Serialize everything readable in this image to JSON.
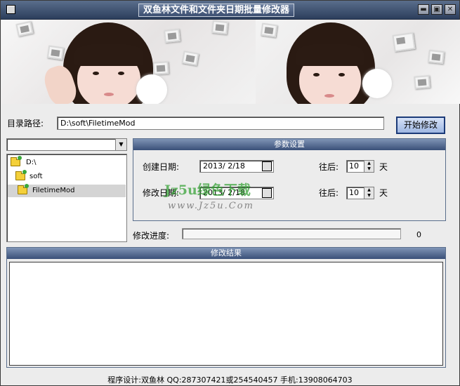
{
  "window": {
    "title": "双鱼林文件和文件夹日期批量修改器",
    "min_glyph": "▬",
    "max_glyph": "▣",
    "close_glyph": "✕"
  },
  "path": {
    "label": "目录路径:",
    "value": "D:\\soft\\FiletimeMod"
  },
  "start_button": "开始修改",
  "drive": {
    "value": "",
    "arrow": "▼"
  },
  "tree": {
    "items": [
      {
        "label": "D:\\"
      },
      {
        "label": "soft"
      },
      {
        "label": "FiletimeMod",
        "selected": true
      }
    ]
  },
  "params": {
    "title": "参数设置",
    "created_label": "创建日期:",
    "created_value": "2013/ 2/18",
    "modified_label": "修改日期:",
    "modified_value": "2013/ 2/18",
    "offset_label": "往后:",
    "created_offset": "10",
    "modified_offset": "10",
    "day_unit": "天"
  },
  "watermark": {
    "text": "Jz5u绿色下载",
    "url": "www.Jz5u.Com"
  },
  "progress": {
    "label": "修改进度:",
    "value": "0",
    "fraction": 0
  },
  "results": {
    "title": "修改结果"
  },
  "footer": "程序设计:双鱼林 QQ:287307421或254540457 手机:13908064703",
  "colors": {
    "title_bar": "#3b4e70",
    "accent_border": "#1b3a78",
    "folder": "#f4d03a"
  }
}
